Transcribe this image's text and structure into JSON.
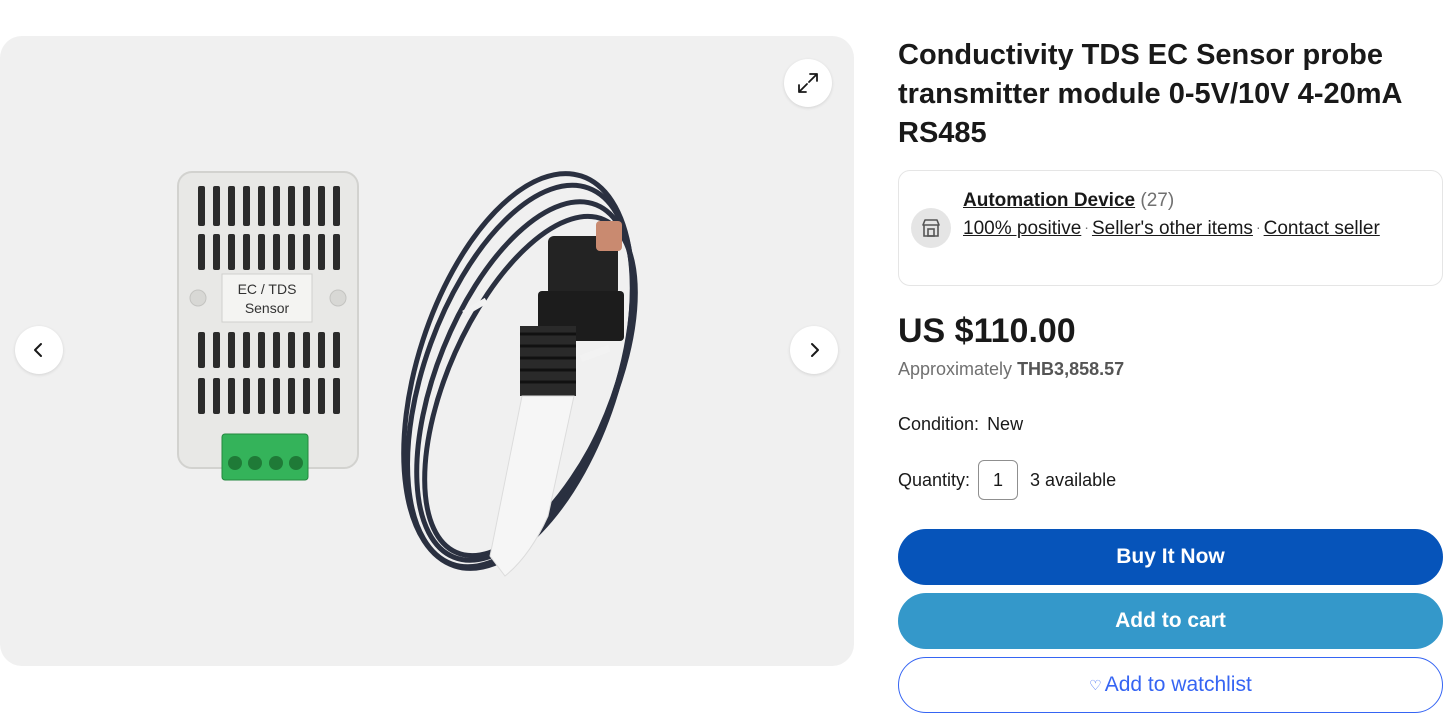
{
  "listing": {
    "title": "Conductivity TDS EC Sensor probe transmitter module 0-5V/10V 4-20mA RS485",
    "image_label": {
      "line1": "EC / TDS",
      "line2": "Sensor"
    }
  },
  "seller": {
    "name": "Automation Device",
    "feedback_count": "(27)",
    "positive": "100% positive",
    "other_items": "Seller's other items",
    "contact": "Contact seller"
  },
  "pricing": {
    "price": "US $110.00",
    "approx_label": "Approximately",
    "approx_value": "THB3,858.57"
  },
  "condition": {
    "label": "Condition:",
    "value": "New"
  },
  "quantity": {
    "label": "Quantity:",
    "value": "1",
    "available": "3 available"
  },
  "actions": {
    "buy_now": "Buy It Now",
    "add_to_cart": "Add to cart",
    "watchlist": "Add to watchlist"
  },
  "icons": {
    "expand": "expand-icon",
    "prev": "chevron-left-icon",
    "next": "chevron-right-icon",
    "store": "store-icon",
    "heart": "heart-icon"
  },
  "colors": {
    "buy_now_bg": "#0654ba",
    "add_to_cart_bg": "#3498ca",
    "watchlist_text": "#3665f3",
    "gallery_bg": "#f0f0f0"
  }
}
